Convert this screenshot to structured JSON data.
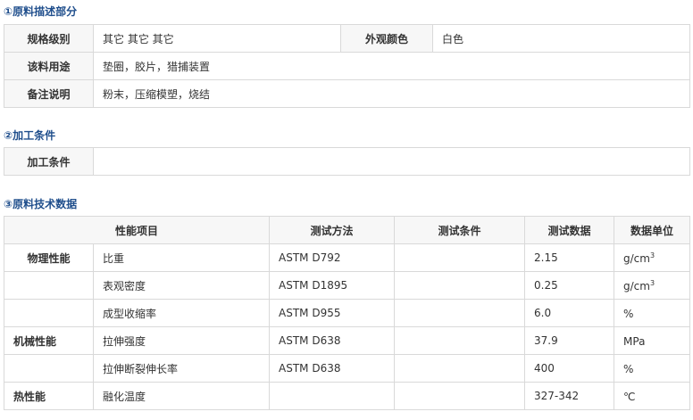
{
  "section1": {
    "title": "①原料描述部分",
    "rows": [
      {
        "label": "规格级别",
        "value": "其它 其它 其它",
        "label2": "外观颜色",
        "value2": "白色"
      },
      {
        "label": "该料用途",
        "value": "垫圈，胶片，猎捕装置"
      },
      {
        "label": "备注说明",
        "value": "粉末，压缩模塑，烧结"
      }
    ]
  },
  "section2": {
    "title": "②加工条件",
    "label": "加工条件",
    "value": ""
  },
  "section3": {
    "title": "③原料技术数据",
    "headers": [
      "性能项目",
      "测试方法",
      "测试条件",
      "测试数据",
      "数据单位"
    ],
    "rows": [
      {
        "category": "物理性能",
        "property": "比重",
        "method": "ASTM D792",
        "condition": "",
        "data": "2.15",
        "unit_base": "g/cm",
        "unit_sup": "3"
      },
      {
        "category": "",
        "property": "表观密度",
        "method": "ASTM D1895",
        "condition": "",
        "data": "0.25",
        "unit_base": "g/cm",
        "unit_sup": "3"
      },
      {
        "category": "",
        "property": "成型收缩率",
        "method": "ASTM D955",
        "condition": "",
        "data": "6.0",
        "unit_base": "%",
        "unit_sup": ""
      },
      {
        "category": "机械性能",
        "property": "拉伸强度",
        "method": "ASTM D638",
        "condition": "",
        "data": "37.9",
        "unit_base": "MPa",
        "unit_sup": ""
      },
      {
        "category": "",
        "property": "拉伸断裂伸长率",
        "method": "ASTM D638",
        "condition": "",
        "data": "400",
        "unit_base": "%",
        "unit_sup": ""
      },
      {
        "category": "热性能",
        "property": "融化温度",
        "method": "",
        "condition": "",
        "data": "327-342",
        "unit_base": "℃",
        "unit_sup": ""
      }
    ]
  }
}
